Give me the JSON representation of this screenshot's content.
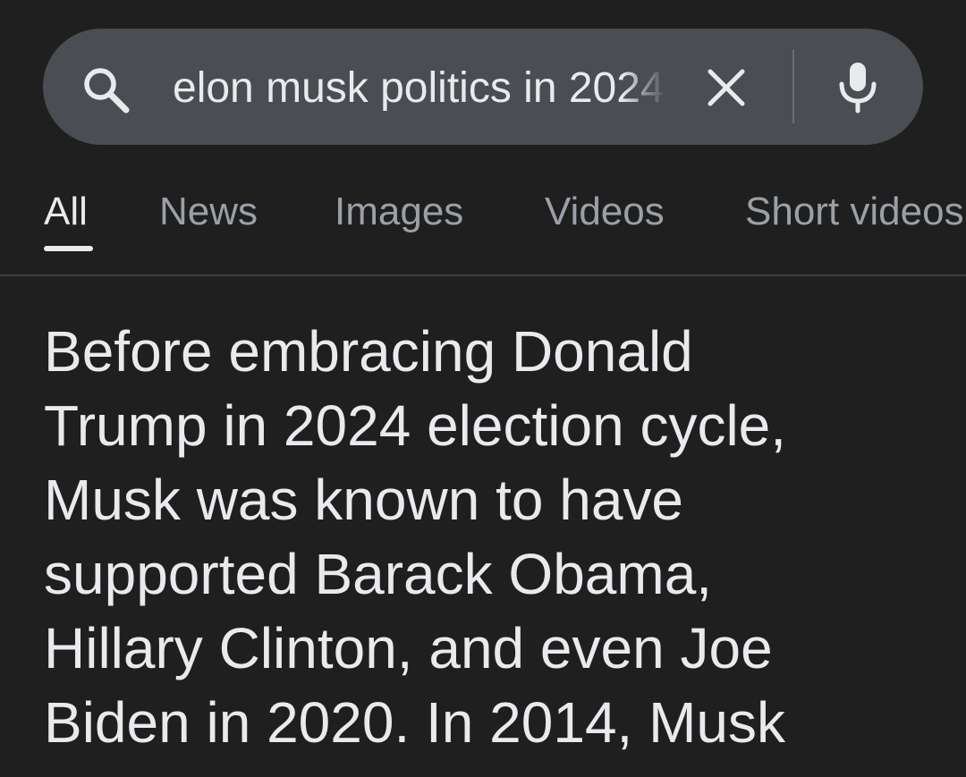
{
  "search": {
    "query": "elon musk politics in 2024",
    "icon": "search-icon",
    "clear_icon": "close-icon",
    "voice_icon": "mic-icon"
  },
  "tabs": [
    {
      "label": "All",
      "active": true
    },
    {
      "label": "News",
      "active": false
    },
    {
      "label": "Images",
      "active": false
    },
    {
      "label": "Videos",
      "active": false
    },
    {
      "label": "Short videos",
      "active": false
    }
  ],
  "result": {
    "lines": [
      "Before embracing Donald",
      "Trump in 2024 election cycle,",
      "Musk was known to have",
      "supported Barack Obama,",
      "Hillary Clinton, and even Joe",
      "Biden in 2020. In 2014, Musk"
    ]
  },
  "colors": {
    "background": "#1f1f1f",
    "search_bar": "#4a4d52",
    "text_primary": "#e8eaed",
    "text_secondary": "#9aa0a6",
    "divider": "#3c4043"
  }
}
